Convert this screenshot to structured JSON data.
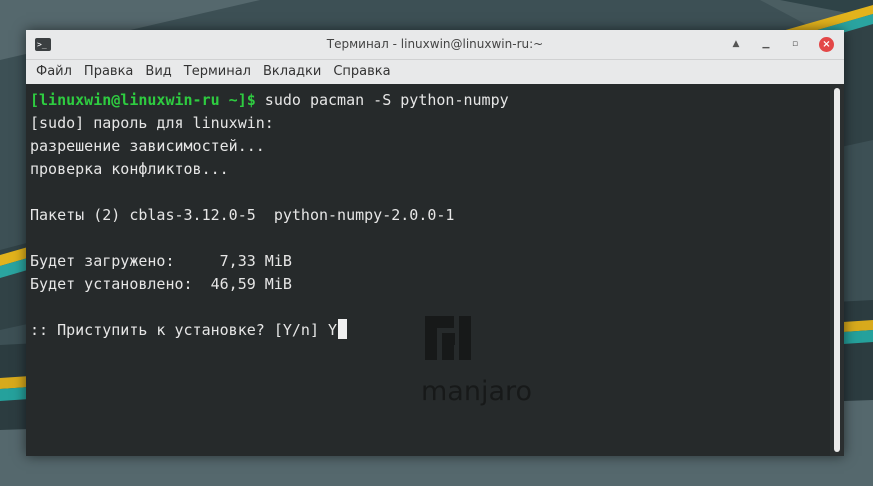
{
  "window": {
    "title": "Терминал - linuxwin@linuxwin-ru:~",
    "icon": "terminal-icon"
  },
  "menu": [
    "Файл",
    "Правка",
    "Вид",
    "Терминал",
    "Вкладки",
    "Справка"
  ],
  "terminal": {
    "prompt": "[linuxwin@linuxwin-ru ~]$",
    "command": " sudo pacman -S python-numpy",
    "output": [
      "[sudo] пароль для linuxwin:",
      "разрешение зависимостей...",
      "проверка конфликтов...",
      "",
      "Пакеты (2) cblas-3.12.0-5  python-numpy-2.0.0-1",
      "",
      "Будет загружено:     7,33 MiB",
      "Будет установлено:  46,59 MiB",
      ""
    ],
    "question": ":: Приступить к установке? [Y/n] Y"
  },
  "watermark": {
    "brand": "manjaro"
  },
  "colors": {
    "prompt": "#2ecc40",
    "close": "#e34747",
    "titlebar": "#e8e9ea"
  }
}
